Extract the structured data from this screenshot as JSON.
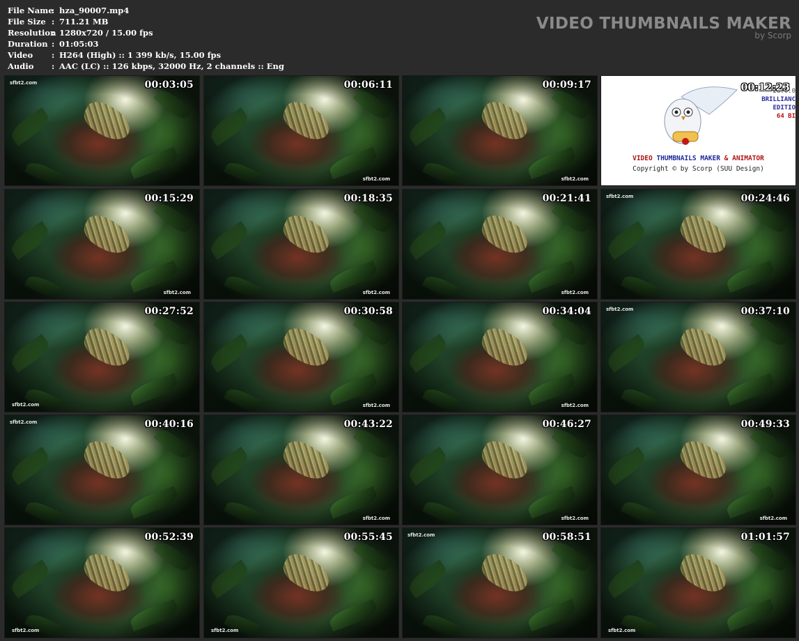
{
  "info": [
    {
      "label": "File Name",
      "sep": ":",
      "value": "hza_90007.mp4"
    },
    {
      "label": "File Size",
      "sep": ":",
      "value": "711.21 MB"
    },
    {
      "label": "Resolution",
      "sep": ":",
      "value": "1280x720 / 15.00 fps"
    },
    {
      "label": "Duration",
      "sep": ":",
      "value": "01:05:03"
    },
    {
      "label": "Video",
      "sep": ":",
      "value": "H264 (High) :: 1 399 kb/s, 15.00 fps"
    },
    {
      "label": "Audio",
      "sep": ":",
      "value": "AAC (LC) :: 126 kbps, 32000 Hz, 2 channels :: Eng"
    }
  ],
  "brand": {
    "title": "VIDEO THUMBNAILS MAKER",
    "subtitle": "by Scorp"
  },
  "watermark": "sfbt2.com",
  "promo": {
    "version": "26.0.0",
    "edition_line1": "BRILLIANC",
    "edition_line2": "EDITIO",
    "bits": "64 BI",
    "title_part1": "VIDEO ",
    "title_part2": "THUMBNAILS MAKER",
    "title_part3": " & ANIMATOR",
    "copyright": "Copyright © by Scorp (SUU Design)"
  },
  "thumbnails": [
    {
      "time": "00:03:05",
      "wm": "tl"
    },
    {
      "time": "00:06:11",
      "wm": "br"
    },
    {
      "time": "00:09:17",
      "wm": "br"
    },
    {
      "time": "00:12:23",
      "promo": true
    },
    {
      "time": "00:15:29",
      "wm": "br"
    },
    {
      "time": "00:18:35",
      "wm": "br"
    },
    {
      "time": "00:21:41",
      "wm": "br"
    },
    {
      "time": "00:24:46",
      "wm": "tl"
    },
    {
      "time": "00:27:52",
      "wm": "bl"
    },
    {
      "time": "00:30:58",
      "wm": "br"
    },
    {
      "time": "00:34:04",
      "wm": "br"
    },
    {
      "time": "00:37:10",
      "wm": "tl"
    },
    {
      "time": "00:40:16",
      "wm": "tl"
    },
    {
      "time": "00:43:22",
      "wm": "br"
    },
    {
      "time": "00:46:27",
      "wm": "br"
    },
    {
      "time": "00:49:33",
      "wm": "br"
    },
    {
      "time": "00:52:39",
      "wm": "bl"
    },
    {
      "time": "00:55:45",
      "wm": "bl"
    },
    {
      "time": "00:58:51",
      "wm": "tl"
    },
    {
      "time": "01:01:57",
      "wm": "bl"
    }
  ]
}
